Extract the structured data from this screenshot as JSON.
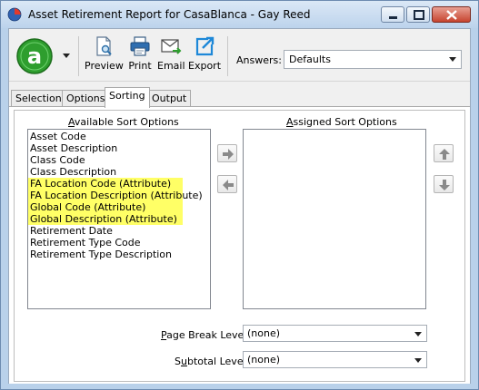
{
  "window": {
    "title": "Asset Retirement Report for CasaBlanca - Gay Reed"
  },
  "toolbar": {
    "buttons": [
      {
        "label": "Preview",
        "icon": "preview-icon"
      },
      {
        "label": "Print",
        "icon": "printer-icon"
      },
      {
        "label": "Email",
        "icon": "email-icon"
      },
      {
        "label": "Export",
        "icon": "export-icon"
      }
    ],
    "answers_label": "Answers:",
    "answers_value": "Defaults"
  },
  "tabs": [
    {
      "label": "Selection",
      "active": false
    },
    {
      "label": "Options",
      "active": false
    },
    {
      "label": "Sorting",
      "active": true
    },
    {
      "label": "Output",
      "active": false
    }
  ],
  "sorting": {
    "available_header_first": "A",
    "available_header_rest": "vailable Sort Options",
    "assigned_header_first": "A",
    "assigned_header_rest": "ssigned Sort Options",
    "available_options": [
      {
        "label": "Asset Code",
        "highlighted": false
      },
      {
        "label": "Asset Description",
        "highlighted": false
      },
      {
        "label": "Class Code",
        "highlighted": false
      },
      {
        "label": "Class Description",
        "highlighted": false
      },
      {
        "label": "FA Location Code (Attribute)",
        "highlighted": true
      },
      {
        "label": "FA Location Description (Attribute)",
        "highlighted": true
      },
      {
        "label": "Global Code (Attribute)",
        "highlighted": true
      },
      {
        "label": "Global Description (Attribute)",
        "highlighted": true
      },
      {
        "label": "Retirement Date",
        "highlighted": false
      },
      {
        "label": "Retirement Type Code",
        "highlighted": false
      },
      {
        "label": "Retirement Type Description",
        "highlighted": false
      }
    ],
    "assigned_options": [],
    "page_break_label_first": "P",
    "page_break_label_rest": "age Break Level:",
    "page_break_value": "(none)",
    "subtotal_label_first": "S",
    "subtotal_label_mid": "u",
    "subtotal_label_rest": "btotal Level:",
    "subtotal_value": "(none)"
  },
  "colors": {
    "highlight": "#ffff66",
    "logo_green": "#2e9e2e",
    "title_bar": "#bcd3ec"
  }
}
